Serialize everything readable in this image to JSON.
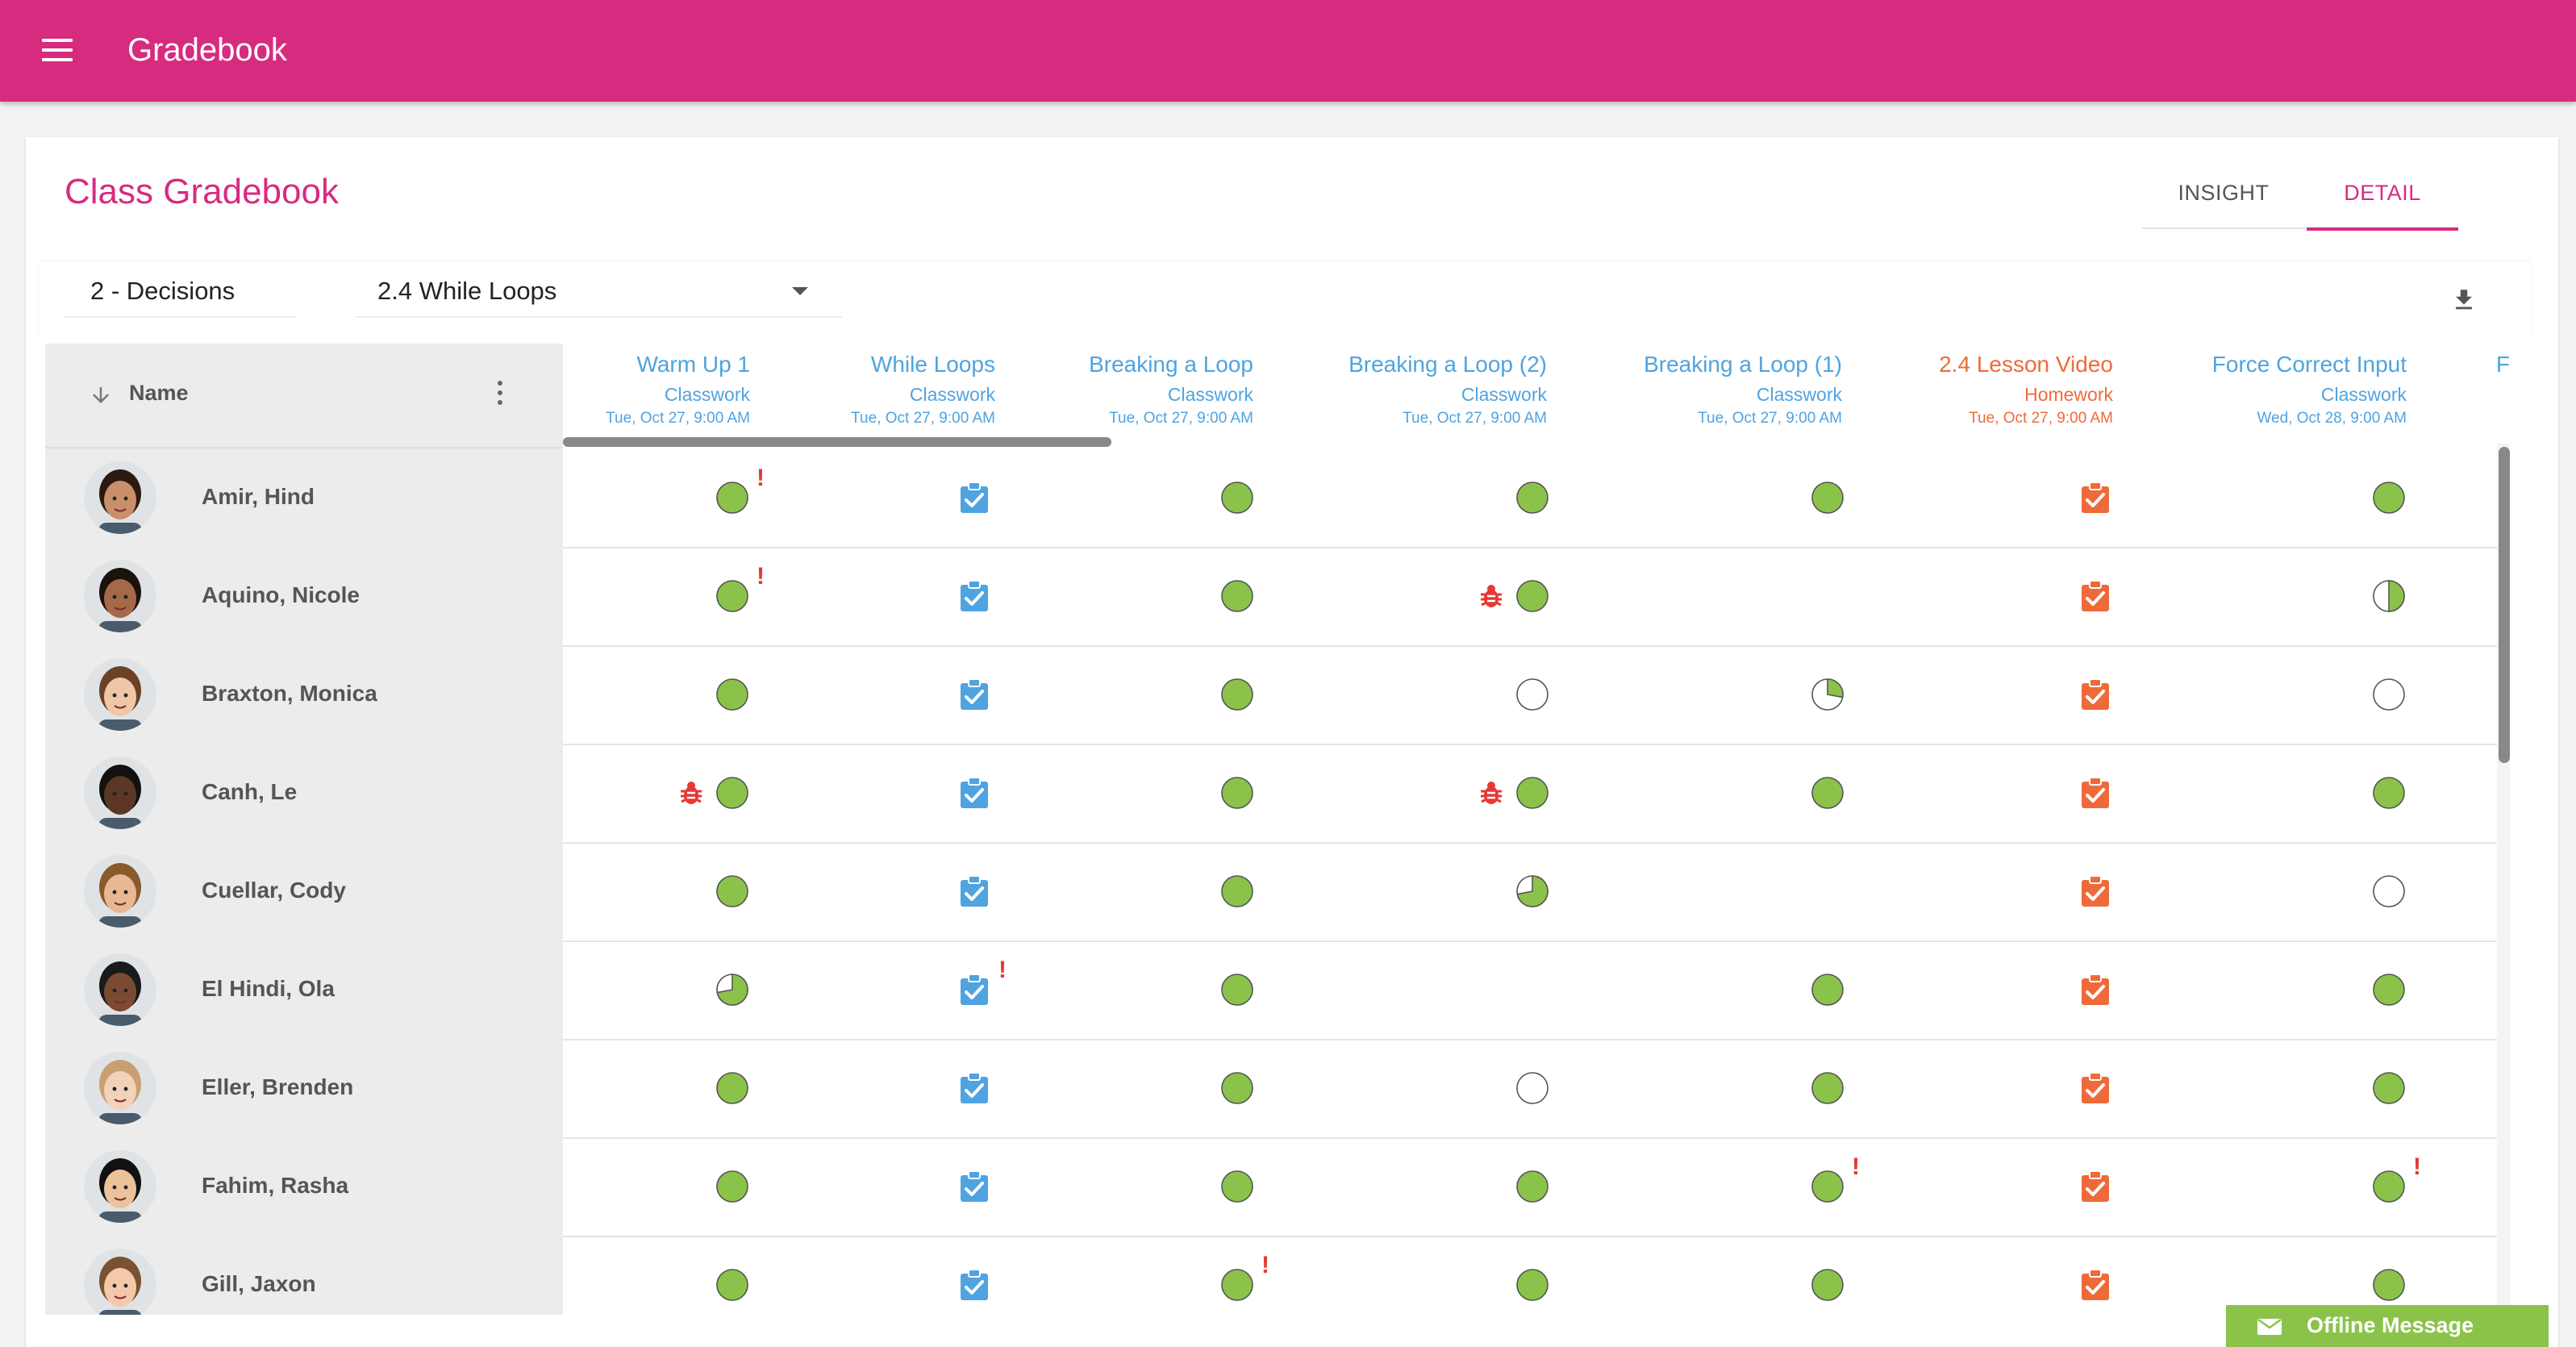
{
  "app": {
    "title": "Gradebook"
  },
  "page": {
    "title": "Class Gradebook"
  },
  "tabs": [
    {
      "label": "INSIGHT"
    },
    {
      "label": "DETAIL"
    }
  ],
  "filters": {
    "unit": "2 - Decisions",
    "lesson": "2.4 While Loops"
  },
  "table": {
    "name_header": "Name",
    "columns": [
      {
        "title": "Warm Up 1",
        "type": "Classwork",
        "date": "Tue, Oct 27, 9:00 AM",
        "color": "#4fa3e0"
      },
      {
        "title": "While Loops",
        "type": "Classwork",
        "date": "Tue, Oct 27, 9:00 AM",
        "color": "#4fa3e0"
      },
      {
        "title": "Breaking a Loop",
        "type": "Classwork",
        "date": "Tue, Oct 27, 9:00 AM",
        "color": "#4fa3e0"
      },
      {
        "title": "Breaking a Loop (2)",
        "type": "Classwork",
        "date": "Tue, Oct 27, 9:00 AM",
        "color": "#4fa3e0"
      },
      {
        "title": "Breaking a Loop (1)",
        "type": "Classwork",
        "date": "Tue, Oct 27, 9:00 AM",
        "color": "#4fa3e0"
      },
      {
        "title": "2.4 Lesson Video",
        "type": "Homework",
        "date": "Tue, Oct 27, 9:00 AM",
        "color": "#ef6a3a"
      },
      {
        "title": "Force Correct Input",
        "type": "Classwork",
        "date": "Wed, Oct 28, 9:00 AM",
        "color": "#4fa3e0"
      },
      {
        "title": "F",
        "type": "",
        "date": "",
        "color": "#4fa3e0"
      }
    ],
    "rows": [
      {
        "name": "Amir, Hind",
        "cells": [
          "full!",
          "check",
          "full",
          "full",
          "full",
          "homework",
          "full"
        ]
      },
      {
        "name": "Aquino, Nicole",
        "cells": [
          "full!",
          "check",
          "full",
          "bug-full",
          "",
          "homework",
          "half"
        ]
      },
      {
        "name": "Braxton, Monica",
        "cells": [
          "full",
          "check",
          "full",
          "empty",
          "quarter",
          "homework",
          "empty"
        ]
      },
      {
        "name": "Canh, Le",
        "cells": [
          "bug-full",
          "check",
          "full",
          "bug-full",
          "full",
          "homework",
          "full"
        ]
      },
      {
        "name": "Cuellar, Cody",
        "cells": [
          "full",
          "check",
          "full",
          "three-quarter",
          "",
          "homework",
          "empty"
        ]
      },
      {
        "name": "El Hindi, Ola",
        "cells": [
          "three-quarter",
          "check!",
          "full",
          "",
          "full",
          "homework",
          "full"
        ]
      },
      {
        "name": "Eller, Brenden",
        "cells": [
          "full",
          "check",
          "full",
          "empty",
          "full",
          "homework",
          "full"
        ]
      },
      {
        "name": "Fahim, Rasha",
        "cells": [
          "full",
          "check",
          "full",
          "full",
          "full!",
          "homework",
          "full!"
        ]
      },
      {
        "name": "Gill, Jaxon",
        "cells": [
          "full",
          "check",
          "full!",
          "full",
          "full",
          "homework",
          "full"
        ]
      }
    ]
  },
  "offline": {
    "label": "Offline Message"
  },
  "colors": {
    "brand": "#d72b7f",
    "progress": "#8bc34a",
    "classwork": "#4fa3e0",
    "homework": "#ef6a3a",
    "alert": "#e53935"
  }
}
